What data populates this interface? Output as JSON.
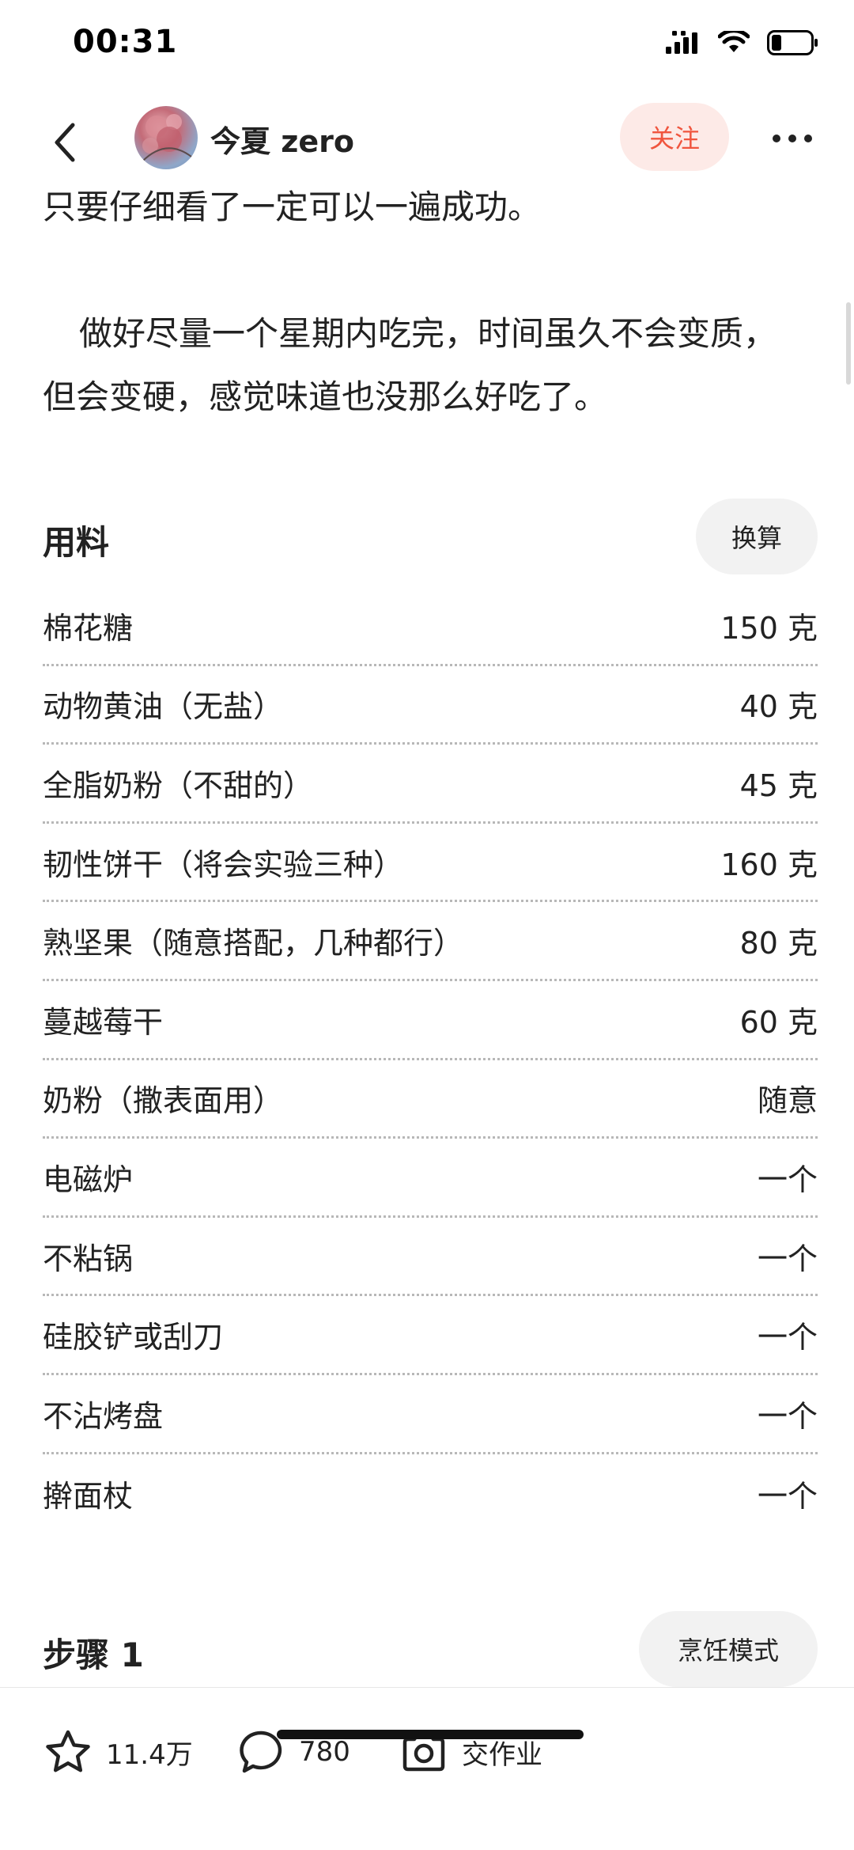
{
  "status_bar": {
    "time": "00:31"
  },
  "nav": {
    "author_name": "今夏 zero",
    "follow_label": "关注"
  },
  "intro": {
    "paragraph1": "只要仔细看了一定可以一遍成功。",
    "paragraph2": "做好尽量一个星期内吃完，时间虽久不会变质，但会变硬，感觉味道也没那么好吃了。"
  },
  "ingredients": {
    "title": "用料",
    "convert_label": "换算",
    "items": [
      {
        "name": "棉花糖",
        "amount": "150 克"
      },
      {
        "name": "动物黄油（无盐）",
        "amount": "40 克"
      },
      {
        "name": "全脂奶粉（不甜的）",
        "amount": "45 克"
      },
      {
        "name": "韧性饼干（将会实验三种）",
        "amount": "160 克"
      },
      {
        "name": "熟坚果（随意搭配，几种都行）",
        "amount": "80 克"
      },
      {
        "name": "蔓越莓干",
        "amount": "60 克"
      },
      {
        "name": "奶粉（撒表面用）",
        "amount": "随意"
      },
      {
        "name": "电磁炉",
        "amount": "一个"
      },
      {
        "name": "不粘锅",
        "amount": "一个"
      },
      {
        "name": "硅胶铲或刮刀",
        "amount": "一个"
      },
      {
        "name": "不沾烤盘",
        "amount": "一个"
      },
      {
        "name": "擀面杖",
        "amount": "一个"
      }
    ]
  },
  "step": {
    "title": "步骤 1",
    "cook_mode_label": "烹饪模式"
  },
  "bottom_bar": {
    "favorites_count": "11.4万",
    "comments_count": "780",
    "homework_label": "交作业"
  },
  "icons": {
    "back": "chevron-left-icon",
    "more": "more-dots-icon",
    "favorite": "star-icon",
    "comment": "comment-bubble-icon",
    "camera": "camera-icon"
  }
}
